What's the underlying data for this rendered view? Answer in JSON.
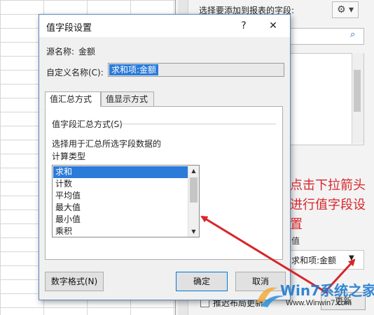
{
  "dialog": {
    "title": "值字段设置",
    "help": "?",
    "close": "✕",
    "source_label": "源名称:",
    "source_value": "金额",
    "custom_name_label": "自定义名称(C):",
    "custom_name_value": "求和项:金额",
    "tabs": [
      {
        "label": "值汇总方式",
        "active": true
      },
      {
        "label": "值显示方式",
        "active": false
      }
    ],
    "summarize": {
      "heading": "值字段汇总方式(S)",
      "description": "选择用于汇总所选字段数据的",
      "calc_label": "计算类型",
      "items": [
        "求和",
        "计数",
        "平均值",
        "最大值",
        "最小值",
        "乘积"
      ],
      "selected": "求和"
    },
    "buttons": {
      "number_format": "数字格式(N)",
      "ok": "确定",
      "cancel": "取消"
    }
  },
  "pane": {
    "title": "选择要添加到报表的字段:",
    "area_label": "值",
    "value_field": "求和项:金额",
    "defer_label": "推迟布局更新",
    "update_button": "更新"
  },
  "annotation": {
    "text": "点击下拉箭头进行值字段设置",
    "color": "#d7262b"
  },
  "watermark": {
    "text": "Win7系统之家",
    "url": "Www.Winwin7.com"
  },
  "colors": {
    "selection": "#2b7bd8",
    "annotation": "#d7262b",
    "dialog_border": "#5a87b8"
  }
}
